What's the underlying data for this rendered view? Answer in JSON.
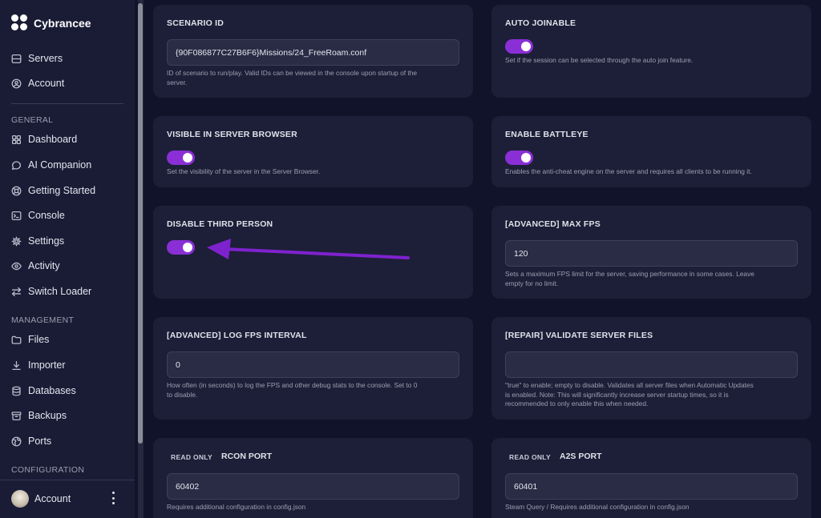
{
  "app": {
    "name": "Cybrancee"
  },
  "sidebar": {
    "top_items": [
      {
        "label": "Servers",
        "icon": "server-icon"
      },
      {
        "label": "Account",
        "icon": "user-circle-icon"
      }
    ],
    "sections": [
      {
        "label": "GENERAL"
      },
      {
        "label": "MANAGEMENT"
      },
      {
        "label": "CONFIGURATION"
      }
    ],
    "general_items": [
      {
        "label": "Dashboard",
        "icon": "grid-icon"
      },
      {
        "label": "AI Companion",
        "icon": "chat-icon"
      },
      {
        "label": "Getting Started",
        "icon": "lifebuoy-icon"
      },
      {
        "label": "Console",
        "icon": "terminal-icon"
      },
      {
        "label": "Settings",
        "icon": "gear-icon"
      },
      {
        "label": "Activity",
        "icon": "eye-icon"
      },
      {
        "label": "Switch Loader",
        "icon": "swap-icon"
      }
    ],
    "management_items": [
      {
        "label": "Files",
        "icon": "folder-icon"
      },
      {
        "label": "Importer",
        "icon": "download-icon"
      },
      {
        "label": "Databases",
        "icon": "database-icon"
      },
      {
        "label": "Backups",
        "icon": "archive-icon"
      },
      {
        "label": "Ports",
        "icon": "globe-icon"
      }
    ],
    "account": {
      "label": "Account"
    }
  },
  "settings": {
    "scenario_id": {
      "title": "SCENARIO ID",
      "value": "{90F086877C27B6F6}Missions/24_FreeRoam.conf",
      "help": [
        "ID of scenario to run/play. Valid IDs can be viewed in the console upon startup of the",
        "server."
      ]
    },
    "auto_joinable": {
      "title": "AUTO JOINABLE",
      "enabled": true,
      "help": "Set if the session can be selected through the auto join feature."
    },
    "visible_in_browser": {
      "title": "VISIBLE IN SERVER BROWSER",
      "enabled": true,
      "help": "Set the visibility of the server in the Server Browser."
    },
    "battleye": {
      "title": "ENABLE BATTLEYE",
      "enabled": true,
      "help": "Enables the anti-cheat engine on the server and requires all clients to be running it."
    },
    "third_person": {
      "title": "DISABLE THIRD PERSON",
      "enabled": true
    },
    "max_fps": {
      "title": "[ADVANCED] MAX FPS",
      "value": "120",
      "help": [
        "Sets a maximum FPS limit for the server, saving performance in some cases. Leave",
        "empty for no limit."
      ]
    },
    "log_fps": {
      "title": "[ADVANCED] LOG FPS INTERVAL",
      "value": "0",
      "help": [
        "How often (in seconds) to log the FPS and other debug stats to the console. Set to 0",
        "to disable."
      ]
    },
    "validate_files": {
      "title": "[REPAIR] VALIDATE SERVER FILES",
      "value": "",
      "help": [
        "\"true\" to enable; empty to disable. Validates all server files when Automatic Updates",
        "is enabled. Note: This will significantly increase server startup times, so it is",
        "recommended to only enable this when needed."
      ]
    },
    "rcon_port": {
      "badge": "READ ONLY",
      "title": "RCON PORT",
      "value": "60402",
      "help": "Requires additional configuration in config.json"
    },
    "a2s_port": {
      "badge": "READ ONLY",
      "title": "A2S PORT",
      "value": "60401",
      "help": "Steam Query / Requires additional configuration in config.json"
    }
  },
  "colors": {
    "accent": "#8a2fd6",
    "arrow": "#7e22ce",
    "background": "#11132a",
    "card": "#1d1f38",
    "sidebar": "#1a1c35"
  }
}
